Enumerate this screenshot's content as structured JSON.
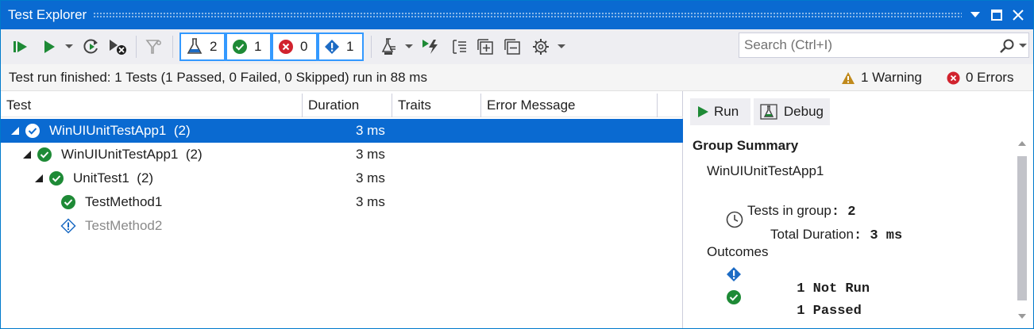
{
  "window": {
    "title": "Test Explorer"
  },
  "toolbar": {
    "counts": {
      "total": "2",
      "passed": "1",
      "failed": "0",
      "not_run": "1"
    },
    "search_placeholder": "Search (Ctrl+I)"
  },
  "status": {
    "message": "Test run finished: 1 Tests (1 Passed, 0 Failed, 0 Skipped) run in 88 ms",
    "warnings": "1 Warning",
    "errors": "0 Errors"
  },
  "columns": [
    "Test",
    "Duration",
    "Traits",
    "Error Message"
  ],
  "tree": [
    {
      "label": "WinUIUnitTestApp1  (2)",
      "duration": "3 ms",
      "icon": "passed-icon",
      "selected": true
    },
    {
      "label": "WinUIUnitTestApp1  (2)",
      "duration": "3 ms",
      "icon": "passed-icon",
      "selected": false
    },
    {
      "label": "UnitTest1  (2)",
      "duration": "3 ms",
      "icon": "passed-icon",
      "selected": false
    },
    {
      "label": "TestMethod1",
      "duration": "3 ms",
      "icon": "passed-icon",
      "selected": false
    },
    {
      "label": "TestMethod2",
      "duration": "",
      "icon": "not-run-icon",
      "selected": false
    }
  ],
  "summary": {
    "run_label": "Run",
    "debug_label": "Debug",
    "title": "Group Summary",
    "group_name": "WinUIUnitTestApp1",
    "tests_in_group_label": "Tests in group",
    "tests_in_group_value": "2",
    "total_duration_label": "Total Duration",
    "total_duration_value": "3 ms",
    "outcomes_label": "Outcomes",
    "not_run_count": "1",
    "not_run_label": "Not Run",
    "passed_count": "1",
    "passed_label": "Passed"
  },
  "colors": {
    "accent": "#0a6ad1",
    "passed": "#1e8a36",
    "failed": "#d1232e",
    "info": "#1c6bc4",
    "warning": "#c08a1c"
  }
}
